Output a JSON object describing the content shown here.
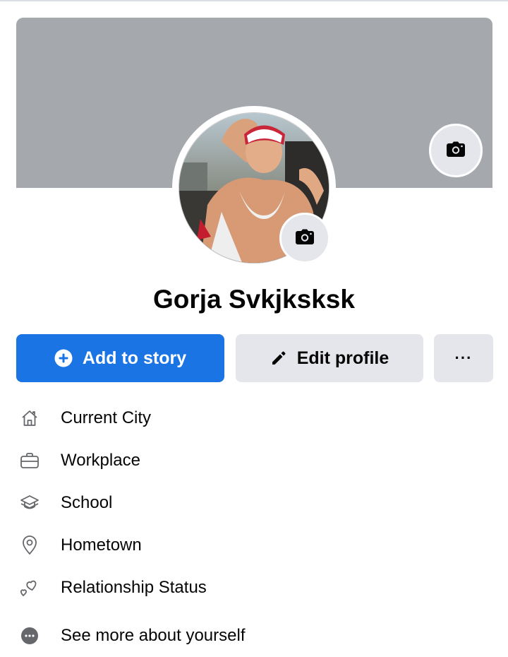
{
  "profile": {
    "name": "Gorja Svkjksksk"
  },
  "actions": {
    "add_story_label": "Add to story",
    "edit_profile_label": "Edit profile",
    "more_label": "···"
  },
  "details": [
    {
      "icon": "home-icon",
      "label": "Current City"
    },
    {
      "icon": "briefcase-icon",
      "label": "Workplace"
    },
    {
      "icon": "graduation-cap-icon",
      "label": "School"
    },
    {
      "icon": "location-pin-icon",
      "label": "Hometown"
    },
    {
      "icon": "hearts-icon",
      "label": "Relationship Status"
    },
    {
      "icon": "more-dots-icon",
      "label": "See more about yourself"
    }
  ],
  "colors": {
    "primary": "#1b74e4",
    "cover": "#a5a8ad",
    "button_gray": "#e4e6eb",
    "text": "#050505"
  }
}
